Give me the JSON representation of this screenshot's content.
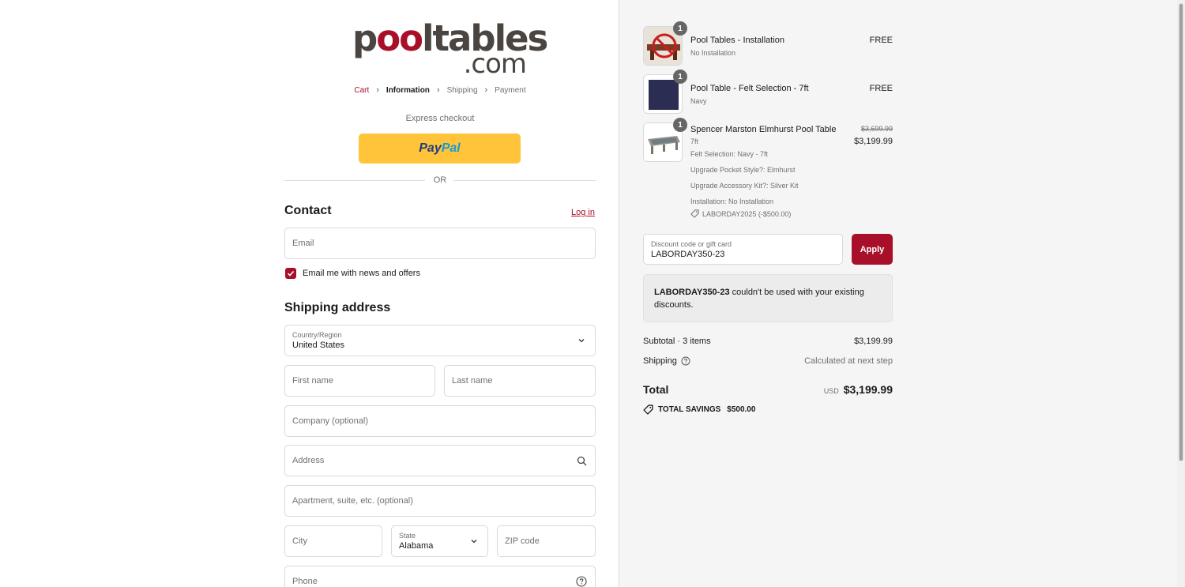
{
  "logo": {
    "left": "p",
    "oo": "oo",
    "right": "ltables",
    "dotcom": ".com"
  },
  "breadcrumb": {
    "cart": "Cart",
    "information": "Information",
    "shipping": "Shipping",
    "payment": "Payment",
    "sep": "›"
  },
  "express": {
    "label": "Express checkout",
    "paypal_pay": "Pay",
    "paypal_pal": "Pal"
  },
  "or_label": "OR",
  "contact": {
    "title": "Contact",
    "login": "Log in",
    "email_placeholder": "Email",
    "newsletter_label": "Email me with news and offers",
    "newsletter_checked": true
  },
  "shipping": {
    "title": "Shipping address",
    "country_label": "Country/Region",
    "country_value": "United States",
    "first_name": "First name",
    "last_name": "Last name",
    "company": "Company (optional)",
    "address": "Address",
    "apartment": "Apartment, suite, etc. (optional)",
    "city": "City",
    "state_label": "State",
    "state_value": "Alabama",
    "zip": "ZIP code",
    "phone": "Phone"
  },
  "order": {
    "items": [
      {
        "name": "Pool Tables - Installation",
        "variant": "No Installation",
        "qty": "1",
        "price": "FREE"
      },
      {
        "name": "Pool Table - Felt Selection - 7ft",
        "variant": "Navy",
        "qty": "1",
        "price": "FREE"
      },
      {
        "name": "Spencer Marston Elmhurst Pool Table",
        "variant": "7ft",
        "qty": "1",
        "original_price": "$3,699.99",
        "price": "$3,199.99",
        "options": [
          "Felt Selection: Navy - 7ft",
          "Upgrade Pocket Style?: Elmhurst",
          "Upgrade Accessory Kit?: Silver Kit",
          "Installation: No Installation"
        ],
        "discount": "LABORDAY2025 (-$500.00)"
      }
    ],
    "discount_label": "Discount code or gift card",
    "discount_value": "LABORDAY350-23",
    "apply_label": "Apply",
    "notice_code": "LABORDAY350-23",
    "notice_text": " couldn't be used with your existing discounts.",
    "subtotal_label": "Subtotal · 3 items",
    "subtotal_value": "$3,199.99",
    "shipping_label": "Shipping",
    "shipping_value": "Calculated at next step",
    "total_label": "Total",
    "currency": "USD",
    "total_value": "$3,199.99",
    "savings_label": "TOTAL SAVINGS",
    "savings_value": "$500.00"
  },
  "colors": {
    "brand": "#a8102a",
    "paypal_yellow": "#ffc439",
    "paypal_dark": "#253b80",
    "paypal_light": "#179bd7"
  }
}
